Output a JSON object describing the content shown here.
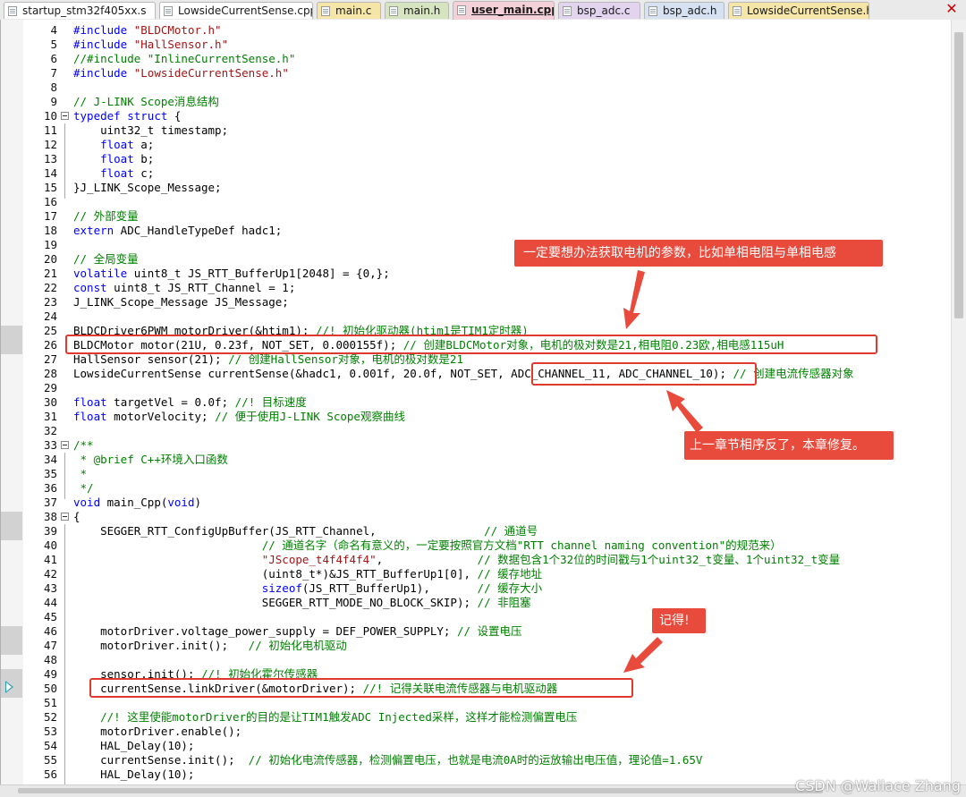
{
  "tabs": [
    {
      "label": "startup_stm32f405xx.s",
      "color": "#ffffff",
      "active": false
    },
    {
      "label": "LowsideCurrentSense.cpp",
      "color": "#ffffff",
      "active": false
    },
    {
      "label": "main.c",
      "color": "#f5e6a8",
      "active": false
    },
    {
      "label": "main.h",
      "color": "#d6e5c0",
      "active": false
    },
    {
      "label": "user_main.cpp",
      "color": "#f4d0d8",
      "active": true
    },
    {
      "label": "bsp_adc.c",
      "color": "#e2d4ee",
      "active": false
    },
    {
      "label": "bsp_adc.h",
      "color": "#d6e2f2",
      "active": false
    },
    {
      "label": "LowsideCurrentSense.h",
      "color": "#f5e6a8",
      "active": false
    }
  ],
  "close_glyph": "✕",
  "lines": [
    {
      "n": "4",
      "t": "#include \"BLDCMotor.h\""
    },
    {
      "n": "5",
      "t": "#include \"HallSensor.h\""
    },
    {
      "n": "6",
      "t": "//#include \"InlineCurrentSense.h\""
    },
    {
      "n": "7",
      "t": "#include \"LowsideCurrentSense.h\""
    },
    {
      "n": "8",
      "t": ""
    },
    {
      "n": "9",
      "t": "// J-LINK Scope消息结构"
    },
    {
      "n": "10",
      "t": "typedef struct {"
    },
    {
      "n": "11",
      "t": "    uint32_t timestamp;"
    },
    {
      "n": "12",
      "t": "    float a;"
    },
    {
      "n": "13",
      "t": "    float b;"
    },
    {
      "n": "14",
      "t": "    float c;"
    },
    {
      "n": "15",
      "t": "}J_LINK_Scope_Message;"
    },
    {
      "n": "16",
      "t": ""
    },
    {
      "n": "17",
      "t": "// 外部变量"
    },
    {
      "n": "18",
      "t": "extern ADC_HandleTypeDef hadc1;"
    },
    {
      "n": "19",
      "t": ""
    },
    {
      "n": "20",
      "t": "// 全局变量"
    },
    {
      "n": "21",
      "t": "volatile uint8_t JS_RTT_BufferUp1[2048] = {0,};"
    },
    {
      "n": "22",
      "t": "const uint8_t JS_RTT_Channel = 1;"
    },
    {
      "n": "23",
      "t": "J_LINK_Scope_Message JS_Message;"
    },
    {
      "n": "24",
      "t": ""
    },
    {
      "n": "25",
      "t": "BLDCDriver6PWM motorDriver(&htim1); //! 初始化驱动器(htim1是TIM1定时器)"
    },
    {
      "n": "26",
      "t": "BLDCMotor motor(21U, 0.23f, NOT_SET, 0.000155f); // 创建BLDCMotor对象，电机的极对数是21,相电阻0.23欧,相电感115uH"
    },
    {
      "n": "27",
      "t": "HallSensor sensor(21); // 创建HallSensor对象，电机的极对数是21"
    },
    {
      "n": "28",
      "t": "LowsideCurrentSense currentSense(&hadc1, 0.001f, 20.0f, NOT_SET, ADC_CHANNEL_11, ADC_CHANNEL_10); // 创建电流传感器对象"
    },
    {
      "n": "29",
      "t": ""
    },
    {
      "n": "30",
      "t": "float targetVel = 0.0f; //! 目标速度"
    },
    {
      "n": "31",
      "t": "float motorVelocity; // 便于使用J-LINK Scope观察曲线"
    },
    {
      "n": "32",
      "t": ""
    },
    {
      "n": "33",
      "t": "/**"
    },
    {
      "n": "34",
      "t": " * @brief C++环境入口函数"
    },
    {
      "n": "35",
      "t": " *"
    },
    {
      "n": "36",
      "t": " */"
    },
    {
      "n": "37",
      "t": "void main_Cpp(void)"
    },
    {
      "n": "38",
      "t": "{"
    },
    {
      "n": "39",
      "t": "    SEGGER_RTT_ConfigUpBuffer(JS_RTT_Channel,                // 通道号"
    },
    {
      "n": "40",
      "t": "                            // 通道名字（命名有意义的，一定要按照官方文档\"RTT channel naming convention\"的规范来）"
    },
    {
      "n": "41",
      "t": "                            \"JScope_t4f4f4f4\",              // 数据包含1个32位的时间戳与1个uint32_t变量、1个uint32_t变量"
    },
    {
      "n": "42",
      "t": "                            (uint8_t*)&JS_RTT_BufferUp1[0], // 缓存地址"
    },
    {
      "n": "43",
      "t": "                            sizeof(JS_RTT_BufferUp1),       // 缓存大小"
    },
    {
      "n": "44",
      "t": "                            SEGGER_RTT_MODE_NO_BLOCK_SKIP); // 非阻塞"
    },
    {
      "n": "45",
      "t": ""
    },
    {
      "n": "46",
      "t": "    motorDriver.voltage_power_supply = DEF_POWER_SUPPLY; // 设置电压"
    },
    {
      "n": "47",
      "t": "    motorDriver.init();   // 初始化电机驱动"
    },
    {
      "n": "48",
      "t": ""
    },
    {
      "n": "49",
      "t": "    sensor.init(); //! 初始化霍尔传感器"
    },
    {
      "n": "50",
      "t": "    currentSense.linkDriver(&motorDriver); //! 记得关联电流传感器与电机驱动器"
    },
    {
      "n": "51",
      "t": ""
    },
    {
      "n": "52",
      "t": "    //! 这里使能motorDriver的目的是让TIM1触发ADC Injected采样，这样才能检测偏置电压"
    },
    {
      "n": "53",
      "t": "    motorDriver.enable();"
    },
    {
      "n": "54",
      "t": "    HAL_Delay(10);"
    },
    {
      "n": "55",
      "t": "    currentSense.init();  // 初始化电流传感器，检测偏置电压，也就是电流0A时的运放输出电压值，理论值=1.65V"
    },
    {
      "n": "56",
      "t": "    HAL_Delay(10);"
    }
  ],
  "callouts": {
    "params": "一定要想办法获取电机的参数，比如单相电阻与单相电感",
    "order": "上一章节相序反了，本章修复。",
    "remember": "记得!"
  },
  "watermark": "CSDN @Wallace Zhang",
  "accent_red": "#e84a3c"
}
